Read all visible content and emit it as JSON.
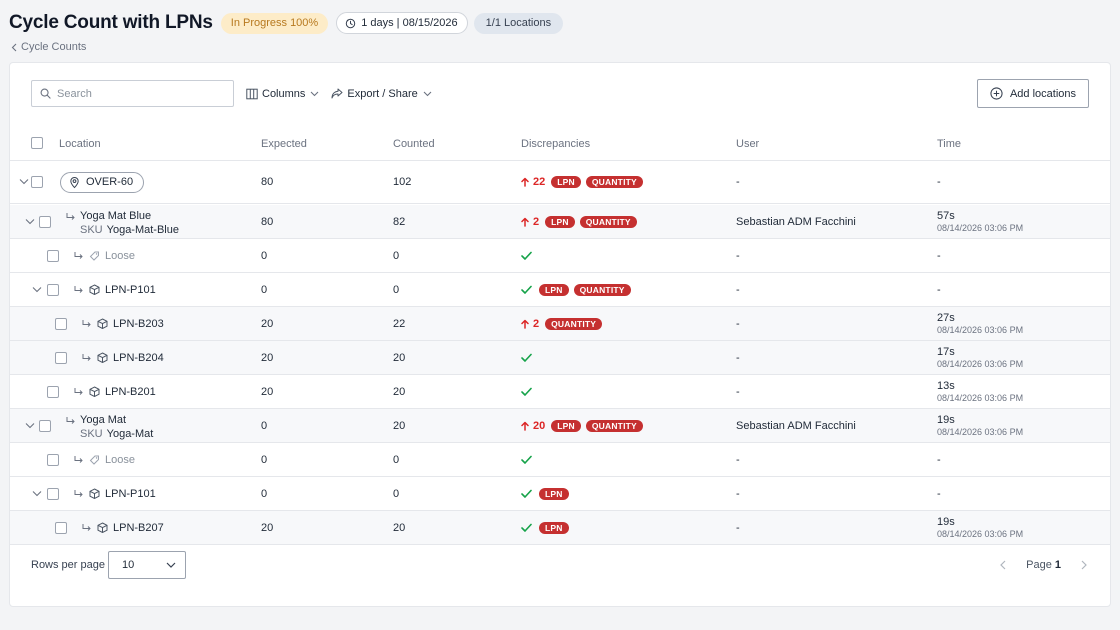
{
  "header": {
    "title": "Cycle Count with LPNs",
    "status": "In Progress 100%",
    "days": "1 days | 08/15/2026",
    "locations": "1/1 Locations"
  },
  "breadcrumb": "Cycle Counts",
  "toolbar": {
    "search_placeholder": "Search",
    "columns_label": "Columns",
    "export_label": "Export / Share",
    "add_locations_label": "Add locations"
  },
  "columns": {
    "location": "Location",
    "expected": "Expected",
    "counted": "Counted",
    "discrepancies": "Discrepancies",
    "user": "User",
    "time": "Time"
  },
  "rows": [
    {
      "kind": "location",
      "label": "OVER-60",
      "expected": "80",
      "counted": "102",
      "disc_value": "22",
      "tags": [
        "LPN",
        "QUANTITY"
      ],
      "user": "-",
      "time": "-",
      "time_sub": ""
    },
    {
      "kind": "product",
      "label": "Yoga Mat Blue",
      "sku_tag": "SKU",
      "sku": "Yoga-Mat-Blue",
      "expected": "80",
      "counted": "82",
      "disc_value": "2",
      "tags": [
        "LPN",
        "QUANTITY"
      ],
      "user": "Sebastian ADM Facchini",
      "time": "57s",
      "time_sub": "08/14/2026 03:06 PM"
    },
    {
      "kind": "loose",
      "label": "Loose",
      "expected": "0",
      "counted": "0",
      "disc_value": "",
      "tags": [],
      "user": "-",
      "time": "-",
      "time_sub": ""
    },
    {
      "kind": "lpn-parent",
      "label": "LPN-P101",
      "expected": "0",
      "counted": "0",
      "disc_value": "",
      "tags": [
        "LPN",
        "QUANTITY"
      ],
      "user": "-",
      "time": "-",
      "time_sub": ""
    },
    {
      "kind": "lpn-child",
      "label": "LPN-B203",
      "expected": "20",
      "counted": "22",
      "disc_value": "2",
      "tags": [
        "QUANTITY"
      ],
      "user": "-",
      "time": "27s",
      "time_sub": "08/14/2026 03:06 PM"
    },
    {
      "kind": "lpn-child",
      "label": "LPN-B204",
      "expected": "20",
      "counted": "20",
      "disc_value": "",
      "tags": [],
      "user": "-",
      "time": "17s",
      "time_sub": "08/14/2026 03:06 PM"
    },
    {
      "kind": "lpn",
      "label": "LPN-B201",
      "expected": "20",
      "counted": "20",
      "disc_value": "",
      "tags": [],
      "user": "-",
      "time": "13s",
      "time_sub": "08/14/2026 03:06 PM"
    },
    {
      "kind": "product",
      "label": "Yoga Mat",
      "sku_tag": "SKU",
      "sku": "Yoga-Mat",
      "expected": "0",
      "counted": "20",
      "disc_value": "20",
      "tags": [
        "LPN",
        "QUANTITY"
      ],
      "user": "Sebastian ADM Facchini",
      "time": "19s",
      "time_sub": "08/14/2026 03:06 PM"
    },
    {
      "kind": "loose",
      "label": "Loose",
      "expected": "0",
      "counted": "0",
      "disc_value": "",
      "tags": [],
      "user": "-",
      "time": "-",
      "time_sub": ""
    },
    {
      "kind": "lpn-parent",
      "label": "LPN-P101",
      "expected": "0",
      "counted": "0",
      "disc_value": "",
      "tags": [
        "LPN"
      ],
      "user": "-",
      "time": "-",
      "time_sub": ""
    },
    {
      "kind": "lpn-child",
      "label": "LPN-B207",
      "expected": "20",
      "counted": "20",
      "disc_value": "",
      "tags": [
        "LPN"
      ],
      "user": "-",
      "time": "19s",
      "time_sub": "08/14/2026 03:06 PM"
    }
  ],
  "footer": {
    "rows_per_page_label": "Rows per page",
    "rows_per_page_value": "10",
    "page_label": "Page",
    "page_number": "1"
  },
  "colors": {
    "discrepancy_red": "#dc2626",
    "tag_red": "#c53030",
    "ok_green": "#16a34a",
    "status_bg": "#fdecc8",
    "status_fg": "#b7791f"
  }
}
